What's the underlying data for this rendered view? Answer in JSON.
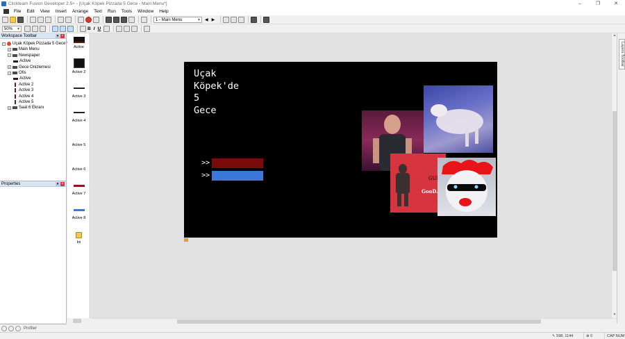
{
  "window": {
    "title": "Clickteam Fusion Developer 2.5+ - [Uçak Köpek Pizzada 5 Gece - Main Menu*]",
    "controls": [
      "–",
      "❐",
      "✕"
    ]
  },
  "menu": [
    "File",
    "Edit",
    "View",
    "Insert",
    "Arrange",
    "Text",
    "Run",
    "Tools",
    "Window",
    "Help"
  ],
  "toolbar": {
    "frame_select": "1 - Main Menu",
    "zoom": "50%",
    "bold": "B",
    "italic": "I",
    "underline": "U"
  },
  "workspace": {
    "header": "Workspace Toolbar",
    "tree": [
      {
        "label": "Uçak Köpek Pizzada 5 Gece *",
        "level": 0,
        "kind": "app",
        "expander": "−"
      },
      {
        "label": "Main Menu",
        "level": 1,
        "kind": "frame",
        "expander": "+"
      },
      {
        "label": "Newspaper",
        "level": 1,
        "kind": "frame",
        "expander": "−"
      },
      {
        "label": "Active",
        "level": 2,
        "kind": "obj",
        "expander": ""
      },
      {
        "label": "Gece Onizlemesi",
        "level": 1,
        "kind": "frame",
        "expander": "+"
      },
      {
        "label": "Ofis",
        "level": 1,
        "kind": "frame",
        "expander": "−"
      },
      {
        "label": "Active",
        "level": 2,
        "kind": "obj",
        "expander": ""
      },
      {
        "label": "Active 2",
        "level": 2,
        "kind": "objv",
        "expander": ""
      },
      {
        "label": "Active 3",
        "level": 2,
        "kind": "objv",
        "expander": ""
      },
      {
        "label": "Active 4",
        "level": 2,
        "kind": "objv",
        "expander": ""
      },
      {
        "label": "Active 5",
        "level": 2,
        "kind": "objv",
        "expander": ""
      },
      {
        "label": "Saat 6 Ekranı",
        "level": 1,
        "kind": "frame",
        "expander": "+"
      }
    ]
  },
  "properties": {
    "header": "Properties"
  },
  "bottom_tabs": {
    "profiler_label": "Profiler"
  },
  "objects": [
    {
      "label": "Active"
    },
    {
      "label": "Active 2"
    },
    {
      "label": "Active 3"
    },
    {
      "label": "Active 4"
    },
    {
      "label": "Active 5"
    },
    {
      "label": "Active 6"
    },
    {
      "label": "Active 7"
    },
    {
      "label": "Active 8"
    },
    {
      "label": "Ini"
    }
  ],
  "frame": {
    "title_lines": [
      "Uçak",
      "Köpek'de",
      "5",
      "Gece"
    ],
    "menu_arrows": [
      ">>",
      ">>"
    ],
    "bar_colors": [
      "#7a0b0b",
      "#3c78d8"
    ],
    "poster_text_1": "GUN",
    "poster_text_2": "GooD.",
    "background": "#000000"
  },
  "layers_tab": "Layers Toolbar",
  "status": {
    "coords": "598, 1144",
    "count": "0",
    "keys": "CAP NUM"
  }
}
